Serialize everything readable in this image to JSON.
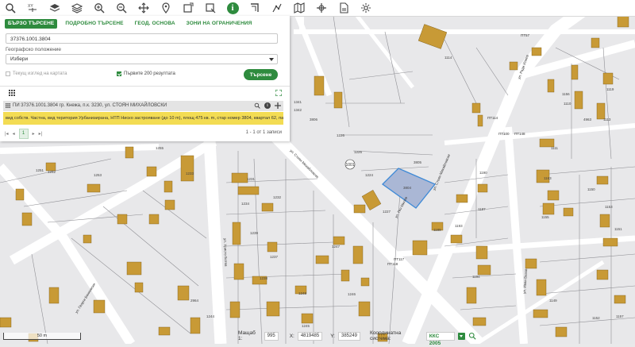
{
  "toolbar": {
    "items": [
      {
        "icon": "search-icon"
      },
      {
        "icon": "coordinates-icon"
      },
      {
        "icon": "layers-icon"
      },
      {
        "icon": "layers-stack-icon"
      },
      {
        "icon": "zoom-in-icon"
      },
      {
        "icon": "zoom-out-icon"
      },
      {
        "icon": "pan-icon"
      },
      {
        "icon": "location-pin-icon"
      },
      {
        "icon": "select-area-icon"
      },
      {
        "icon": "select-shape-icon"
      },
      {
        "icon": "info-icon",
        "active": true
      },
      {
        "icon": "measure-icon"
      },
      {
        "icon": "draw-icon"
      },
      {
        "icon": "map-icon"
      },
      {
        "icon": "crosshair-icon"
      },
      {
        "icon": "pdf-icon"
      },
      {
        "icon": "settings-icon"
      }
    ],
    "info_symbol": "i"
  },
  "panel": {
    "tabs": [
      "БЪРЗО ТЪРСЕНЕ",
      "ПОДРОБНО ТЪРСЕНЕ",
      "ГЕОД. ОСНОВА",
      "ЗОНИ НА ОГРАНИЧЕНИЯ"
    ],
    "active_tab": 0,
    "search_value": "37376.1001.3804",
    "location_label": "Географско положение",
    "location_value": "Избери",
    "current_view_label": "Текущ изглед на картата",
    "current_view_checked": false,
    "first200_label": "Първите 200 резултата",
    "first200_checked": true,
    "search_button": "Търсене",
    "result_title": "ПИ 37376.1001.3804 гр. Кнежа, п.к. 3230, ул. СТОЯН МИХАЙЛОВСКИ",
    "result_detail": "вид собств. Частна, вид територия Урбанизирана, НТП Ниско застрояване (до 10 m), площ 475 кв. m, стар номер 3804, квартал 62, парцел XVI",
    "page_current": "1",
    "count_text": "1 - 1 от 1 записи"
  },
  "map": {
    "street_labels": [
      "ул. Стоян Михайловски",
      "ул. Стоян Михайловски",
      "ул. Христо Ботев",
      "ул. Ради Илиев",
      "ул. Георги Бенковски",
      "ул. Гео Милев",
      "ул. Иван Вазов"
    ],
    "parcel_labels": [
      "1341",
      "1342",
      "3806",
      "1226",
      "1225",
      "1224",
      "3805",
      "3804",
      "1227",
      "1190",
      "1163",
      "1251",
      "1252",
      "1253",
      "1255",
      "1233",
      "1231",
      "1234",
      "1232",
      "1239",
      "1237",
      "1238",
      "1247",
      "1248",
      "2964",
      "1244",
      "1245",
      "1246",
      "1194",
      "1189",
      "1193",
      "1187",
      "1155",
      "1149",
      "1150",
      "1153",
      "1151",
      "1152",
      "1157",
      "1156",
      "1110",
      "1119",
      "1111",
      "4963",
      "1113",
      "1114",
      "1112",
      "1120",
      "1249",
      "1250",
      "1212",
      "1211",
      "1213",
      "1214",
      "1215",
      "1216",
      "1217",
      "1218",
      "1158",
      "1161"
    ],
    "kvartal_label": "1001",
    "block_labels": [
      "ПТ57",
      "ПТ114",
      "ПТ100",
      "ПТ148",
      "ПТ117",
      "ПТ118"
    ],
    "colors": {
      "building": "#c89a36",
      "highlight": "#aab7d5",
      "highlight_border": "#3f8ad6",
      "street": "#ffffff",
      "ground": "#e8e8ea"
    }
  },
  "scale_text": "50 m",
  "status": {
    "scale_label": "Мащаб 1:",
    "scale_value": "995",
    "x_label": "X:",
    "x_value": "4819485",
    "y_label": "Y:",
    "y_value": "385249",
    "crs_label": "Координатна система:",
    "crs_value": "ККС 2005"
  }
}
